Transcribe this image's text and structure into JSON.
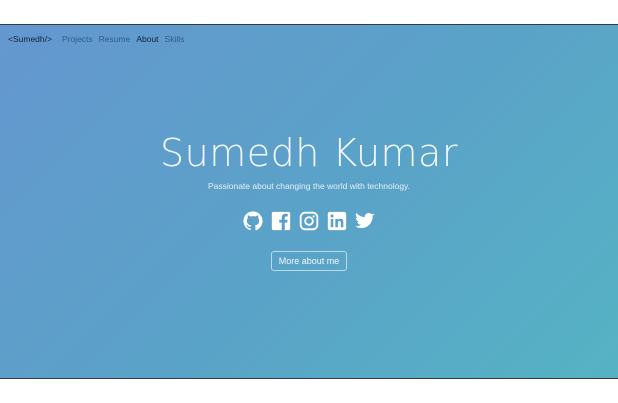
{
  "nav": {
    "brand": "<Sumedh/>",
    "links": [
      {
        "label": "Projects"
      },
      {
        "label": "Resume"
      },
      {
        "label": "About"
      },
      {
        "label": "Skills"
      }
    ]
  },
  "hero": {
    "name": "Sumedh Kumar",
    "tagline": "Passionate about changing the world with technology.",
    "button_label": "More about me"
  },
  "socials": [
    {
      "icon": "github-icon"
    },
    {
      "icon": "facebook-icon"
    },
    {
      "icon": "instagram-icon"
    },
    {
      "icon": "linkedin-icon"
    },
    {
      "icon": "twitter-icon"
    }
  ],
  "colors": {
    "gradient_start": "#6497cf",
    "gradient_end": "#55b3c4",
    "text": "#f4f8fc",
    "nav_dark": "#11233a",
    "nav_muted": "#2f5d8a"
  }
}
